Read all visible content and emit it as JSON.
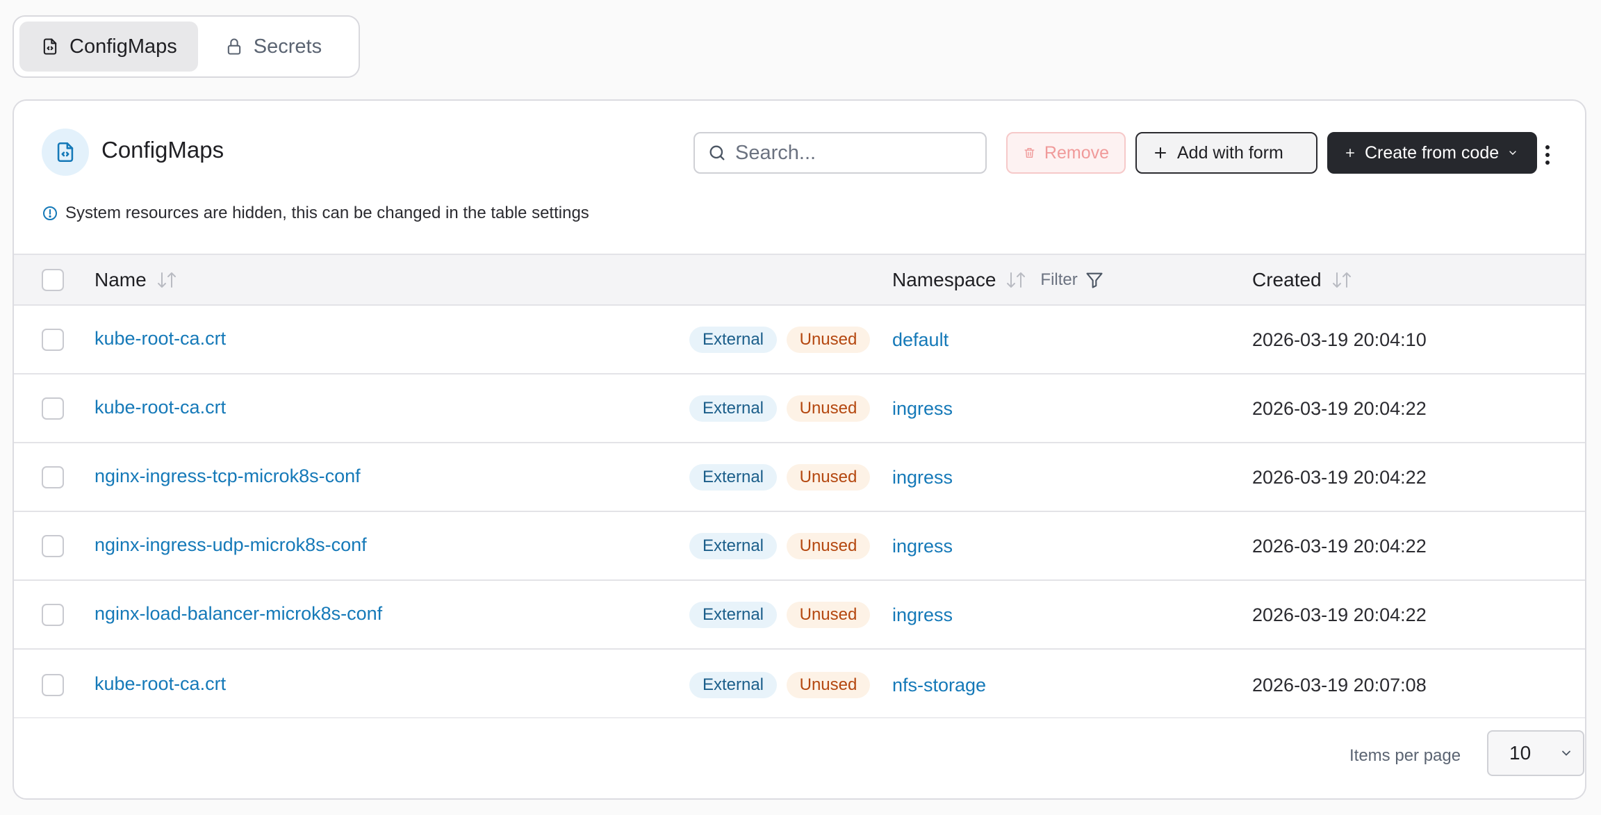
{
  "tabs": [
    {
      "label": "ConfigMaps",
      "icon": "file-code-icon",
      "active": true
    },
    {
      "label": "Secrets",
      "icon": "lock-icon",
      "active": false
    }
  ],
  "header": {
    "title": "ConfigMaps",
    "title_icon": "file-code-icon",
    "search_placeholder": "Search...",
    "remove_label": "Remove",
    "add_label": "Add with form",
    "create_label": "Create from code",
    "info_note": "System resources are hidden, this can be changed in the table settings"
  },
  "table": {
    "columns": {
      "name": "Name",
      "namespace": "Namespace",
      "filter": "Filter",
      "created": "Created"
    },
    "rows": [
      {
        "name": "kube-root-ca.crt",
        "badges": [
          "External",
          "Unused"
        ],
        "namespace": "default",
        "created": "2026-03-19 20:04:10"
      },
      {
        "name": "kube-root-ca.crt",
        "badges": [
          "External",
          "Unused"
        ],
        "namespace": "ingress",
        "created": "2026-03-19 20:04:22"
      },
      {
        "name": "nginx-ingress-tcp-microk8s-conf",
        "badges": [
          "External",
          "Unused"
        ],
        "namespace": "ingress",
        "created": "2026-03-19 20:04:22"
      },
      {
        "name": "nginx-ingress-udp-microk8s-conf",
        "badges": [
          "External",
          "Unused"
        ],
        "namespace": "ingress",
        "created": "2026-03-19 20:04:22"
      },
      {
        "name": "nginx-load-balancer-microk8s-conf",
        "badges": [
          "External",
          "Unused"
        ],
        "namespace": "ingress",
        "created": "2026-03-19 20:04:22"
      },
      {
        "name": "kube-root-ca.crt",
        "badges": [
          "External",
          "Unused"
        ],
        "namespace": "nfs-storage",
        "created": "2026-03-19 20:07:08"
      }
    ]
  },
  "footer": {
    "items_per_page_label": "Items per page",
    "items_per_page_value": "10"
  },
  "colors": {
    "link": "#1579b8",
    "primary_button": "#26282d",
    "external_badge_bg": "#e8f3fa",
    "unused_badge_bg": "#fdf2e6",
    "unused_badge_text": "#b4470f"
  }
}
